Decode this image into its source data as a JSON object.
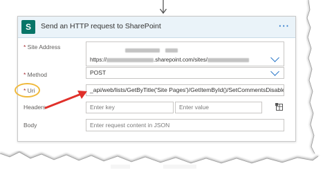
{
  "action": {
    "title": "Send an HTTP request to SharePoint",
    "icon": "sharepoint-icon",
    "menu_icon": "more-options-icon",
    "menu_label": "···"
  },
  "fields": {
    "site_address": {
      "label": "Site Address",
      "required": true,
      "value_prefix": "https://",
      "value_middle": ".sharepoint.com/sites/"
    },
    "method": {
      "label": "Method",
      "required": true,
      "value": "POST"
    },
    "uri": {
      "label": "Uri",
      "required": true,
      "value": "_api/web/lists/GetByTitle('Site Pages')/GetItemById()/SetCommentsDisabled"
    },
    "headers": {
      "label": "Headers",
      "key_placeholder": "Enter key",
      "value_placeholder": "Enter value",
      "switch_icon": "switch-to-text-icon"
    },
    "body": {
      "label": "Body",
      "placeholder": "Enter request content in JSON"
    }
  },
  "colors": {
    "accent": "#2b78c9",
    "header_bg": "#eaf3f9",
    "sharepoint_teal": "#077568",
    "required_asterisk": "#a4262c",
    "highlight_circle": "#f0b93b",
    "arrow": "#e0302a"
  }
}
